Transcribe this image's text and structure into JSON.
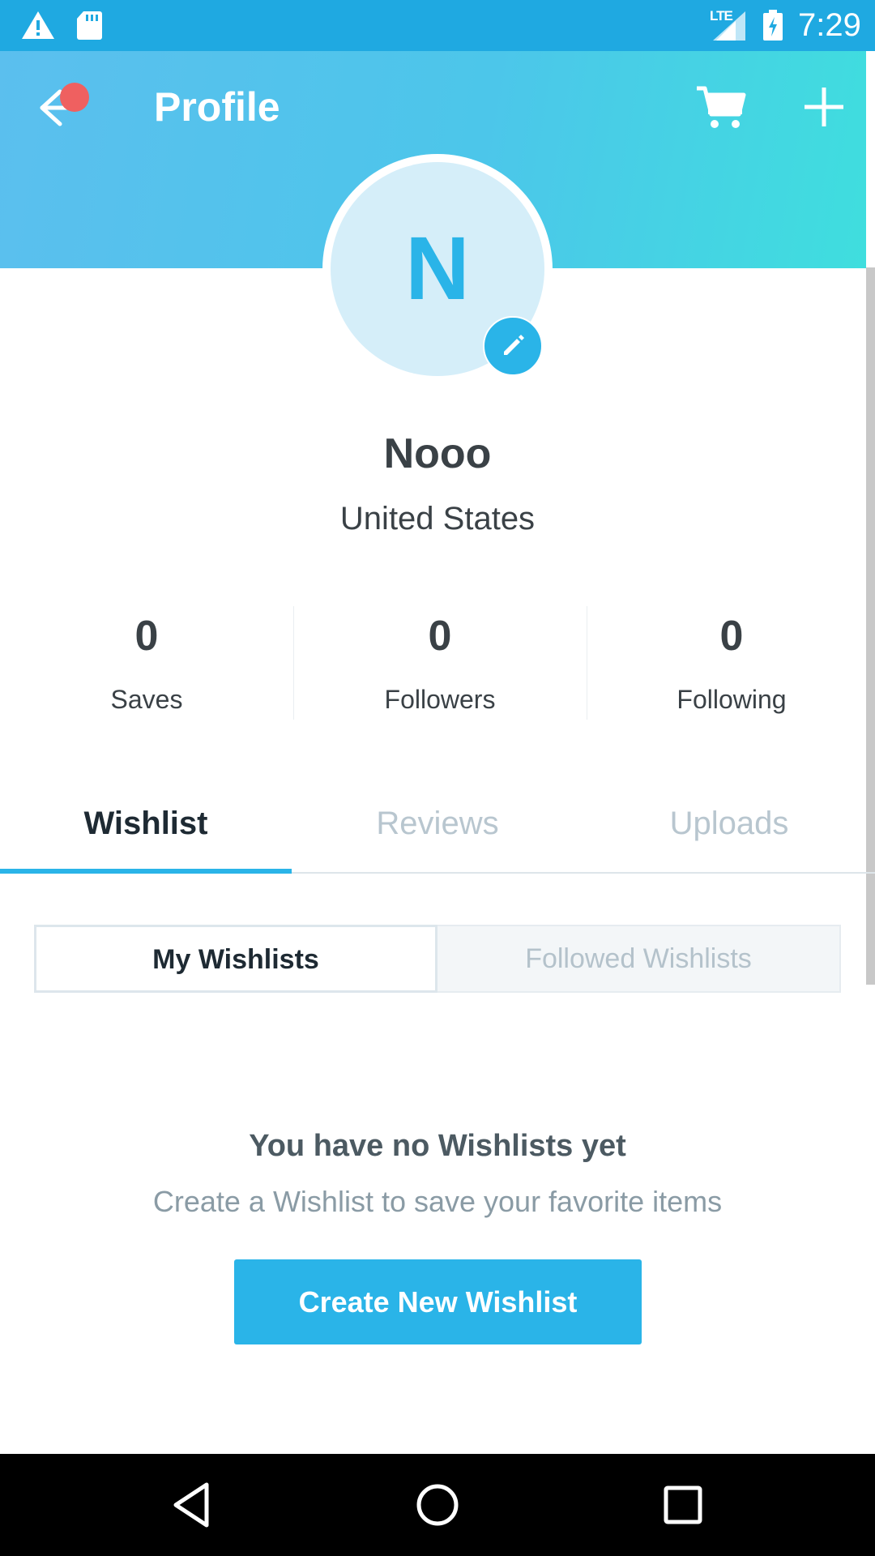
{
  "status_bar": {
    "time": "7:29",
    "network": "LTE",
    "icons": [
      "warning-icon",
      "sd-card-icon",
      "signal-icon",
      "battery-charging-icon"
    ]
  },
  "header": {
    "title": "Profile",
    "icons": [
      "back-arrow-icon",
      "cart-icon",
      "plus-icon"
    ],
    "gradient_colors": [
      "#5bbfee",
      "#3fdede"
    ],
    "notification_dot_color": "#ef6060"
  },
  "profile": {
    "avatar_initial": "N",
    "name": "Nooo",
    "location": "United States",
    "edit_icon": "pencil-icon"
  },
  "stats": [
    {
      "value": "0",
      "label": "Saves"
    },
    {
      "value": "0",
      "label": "Followers"
    },
    {
      "value": "0",
      "label": "Following"
    }
  ],
  "tabs": [
    {
      "label": "Wishlist",
      "active": true
    },
    {
      "label": "Reviews",
      "active": false
    },
    {
      "label": "Uploads",
      "active": false
    }
  ],
  "segments": [
    {
      "label": "My Wishlists",
      "active": true
    },
    {
      "label": "Followed Wishlists",
      "active": false
    }
  ],
  "empty_state": {
    "title": "You have no Wishlists yet",
    "subtitle": "Create a Wishlist to save your favorite items",
    "button_label": "Create New Wishlist"
  },
  "colors": {
    "accent": "#2ab4e8",
    "text_dark": "#3a4146",
    "text_muted": "#b8c6cf"
  },
  "nav_bar": {
    "icons": [
      "back-triangle-icon",
      "home-circle-icon",
      "recents-square-icon"
    ]
  }
}
